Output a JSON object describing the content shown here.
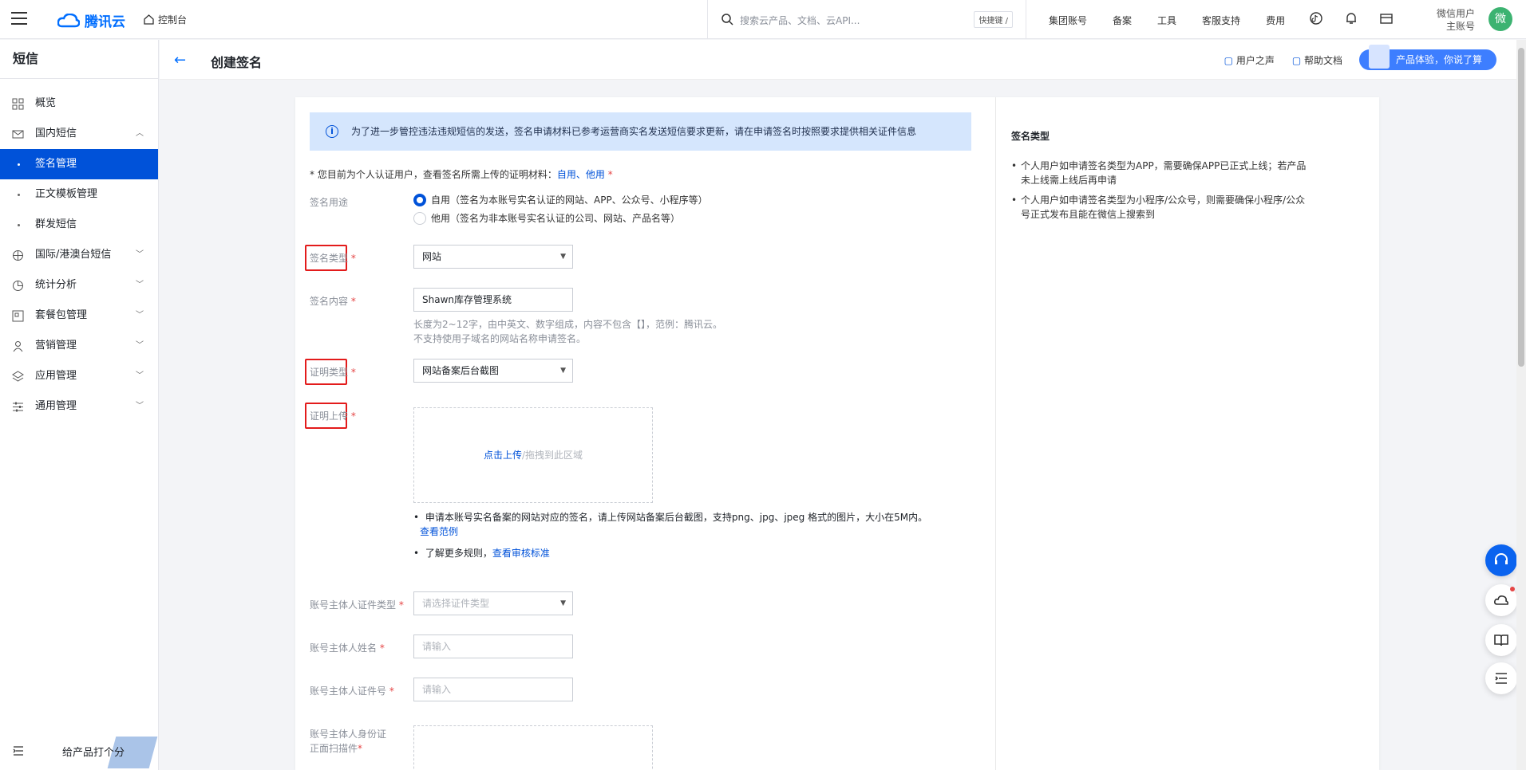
{
  "topbar": {
    "brand": "腾讯云",
    "console": "控制台",
    "search_placeholder": "搜索云产品、文档、云API...",
    "shortcut": "快捷键 /",
    "nav": [
      "集团账号",
      "备案",
      "工具",
      "客服支持",
      "费用"
    ],
    "user_line1": "微信用户",
    "user_line2": "主账号",
    "avatar": "微"
  },
  "sidebar": {
    "title": "短信",
    "items": [
      {
        "label": "概览",
        "icon": "grid-icon",
        "chevron": ""
      },
      {
        "label": "国内短信",
        "icon": "mail-icon",
        "chevron": "︿"
      }
    ],
    "subitems": [
      "签名管理",
      "正文模板管理",
      "群发短信"
    ],
    "more_items": [
      {
        "label": "国际/港澳台短信",
        "icon": "globe-icon"
      },
      {
        "label": "统计分析",
        "icon": "pie-icon"
      },
      {
        "label": "套餐包管理",
        "icon": "package-icon"
      },
      {
        "label": "营销管理",
        "icon": "user-icon"
      },
      {
        "label": "应用管理",
        "icon": "layers-icon"
      },
      {
        "label": "通用管理",
        "icon": "sliders-icon"
      }
    ],
    "feedback": "给产品打个分"
  },
  "header": {
    "title": "创建签名",
    "links": [
      "用户之声",
      "帮助文档"
    ],
    "promo": "产品体验，你说了算"
  },
  "form": {
    "notice": "为了进一步管控违法违规短信的发送，签名申请材料已参考运营商实名发送短信要求更新，请在申请签名时按照要求提供相关证件信息",
    "hint_prefix": "* 您目前为个人认证用户，查看签名所需上传的证明材料：",
    "hint_link1": "自用",
    "hint_sep": "、",
    "hint_link2": "他用",
    "hint_suffix": " *",
    "usage_label": "签名用途",
    "usage_opt1": "自用（签名为本账号实名认证的网站、APP、公众号、小程序等）",
    "usage_opt2": "他用（签名为非本账号实名认证的公司、网站、产品名等）",
    "type_label": "签名类型",
    "type_value": "网站",
    "content_label": "签名内容",
    "content_value": "Shawn库存管理系统",
    "content_help1": "长度为2~12字，由中英文、数字组成，内容不包含【】，范例：腾讯云。",
    "content_help2": "不支持使用子域名的网站名称申请签名。",
    "proof_type_label": "证明类型",
    "proof_type_value": "网站备案后台截图",
    "proof_upload_label": "证明上传",
    "upload_link": "点击上传",
    "upload_text": "/拖拽到此区域",
    "upload_note": "申请本账号实名备案的网站对应的签名，请上传网站备案后台截图，支持png、jpg、jpeg 格式的图片，大小在5M内。",
    "upload_example": "查看范例",
    "rules_prefix": "了解更多规则，",
    "rules_link": "查看审核标准",
    "owner_id_type_label": "账号主体人证件类型",
    "owner_id_type_placeholder": "请选择证件类型",
    "owner_name_label": "账号主体人姓名",
    "owner_name_placeholder": "请输入",
    "owner_id_no_label": "账号主体人证件号",
    "owner_id_no_placeholder": "请输入",
    "owner_scan_label1": "账号主体人身份证",
    "owner_scan_label2": "正面扫描件",
    "required_mark": "*"
  },
  "side_tips": {
    "title": "签名类型",
    "tip1": "个人用户如申请签名类型为APP，需要确保APP已正式上线；若产品未上线需上线后再申请",
    "tip2": "个人用户如申请签名类型为小程序/公众号，则需要确保小程序/公众号正式发布且能在微信上搜索到"
  },
  "colors": {
    "primary": "#0052d9",
    "highlight": "#e31b1b",
    "notice_bg": "#d5e6fd"
  }
}
